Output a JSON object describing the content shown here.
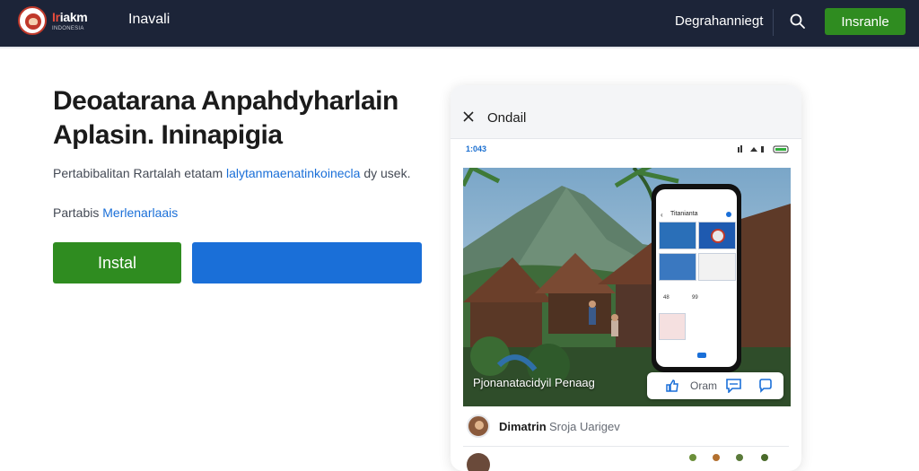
{
  "navbar": {
    "logo_word_a": "Ir",
    "logo_word_b": "iakm",
    "logo_subtitle": "INDONESIA",
    "nav_link": "Inavali",
    "right_link": "Degrahanniegt",
    "button_label": "Insranle"
  },
  "hero": {
    "title_line1": "Deoatarana Anpahdyharlain",
    "title_line2": "Aplasin. Ininapigia",
    "description_a": "Pertabibalitan Rartalah etatam ",
    "description_link": "lalytanmaenatinkoinecla",
    "description_b": " dy usek.",
    "meta_label": "Partabis ",
    "meta_link": "Merlenarlaais",
    "install_button": "Instal",
    "secondary_button": ""
  },
  "card": {
    "title": "Ondail",
    "status_time": "1:043",
    "photo_caption": "Pjonanatacidyil Penaag",
    "toolbar_label": "Oram",
    "mini_phone": {
      "title": "Titanianta",
      "stat_a": "48",
      "stat_b": "99"
    },
    "comment": {
      "name": "Dimatrin",
      "text": "Sroja Uarigev"
    }
  },
  "colors": {
    "navbar_bg": "#1c2438",
    "accent_green": "#2f8c20",
    "accent_blue": "#1a6fd8",
    "brand_red": "#c0392b"
  },
  "icons": [
    "logo-icon",
    "search-icon",
    "close-icon",
    "like-icon",
    "comment-icon",
    "chat-icon",
    "wifi-icon",
    "battery-icon"
  ]
}
